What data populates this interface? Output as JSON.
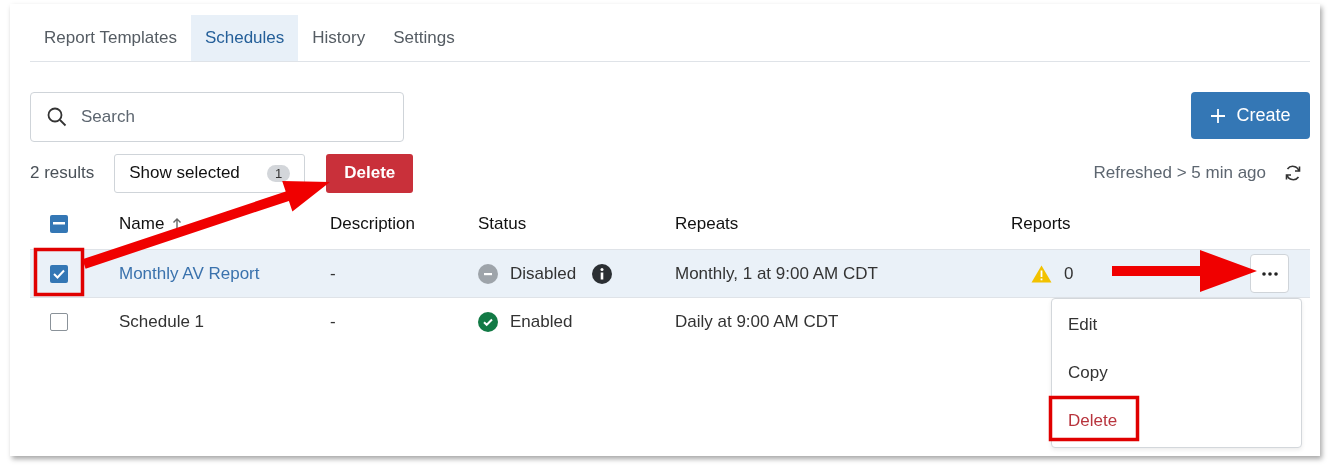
{
  "tabs": [
    {
      "label": "Report Templates",
      "selected": false
    },
    {
      "label": "Schedules",
      "selected": true
    },
    {
      "label": "History",
      "selected": false
    },
    {
      "label": "Settings",
      "selected": false
    }
  ],
  "search": {
    "placeholder": "Search"
  },
  "create_button": {
    "label": "Create"
  },
  "toolbar": {
    "results": "2 results",
    "show_selected": {
      "label": "Show selected",
      "count": "1"
    },
    "delete_button": "Delete",
    "refreshed": "Refreshed > 5 min ago"
  },
  "table": {
    "select_all": {
      "indeterminate": true
    },
    "columns": [
      {
        "label": "Name",
        "sorted": true
      },
      {
        "label": "Description",
        "sorted": false
      },
      {
        "label": "Status",
        "sorted": false
      },
      {
        "label": "Repeats",
        "sorted": false
      },
      {
        "label": "Reports",
        "sorted": false
      }
    ],
    "rows": [
      {
        "selected": true,
        "checked": true,
        "name": "Monthly AV Report",
        "description": "-",
        "status": {
          "kind": "disabled",
          "label": "Disabled",
          "info": true
        },
        "repeats": "Monthly, 1 at 9:00 AM CDT",
        "reports": {
          "warning": true,
          "count": "0"
        }
      },
      {
        "selected": false,
        "checked": false,
        "name": "Schedule 1",
        "description": "-",
        "status": {
          "kind": "enabled",
          "label": "Enabled"
        },
        "repeats": "Daily at 9:00 AM CDT"
      }
    ]
  },
  "row_menu": {
    "open": true,
    "items": [
      {
        "label": "Edit",
        "kind": "default"
      },
      {
        "label": "Copy",
        "kind": "default"
      },
      {
        "label": "Delete",
        "kind": "danger"
      }
    ]
  }
}
